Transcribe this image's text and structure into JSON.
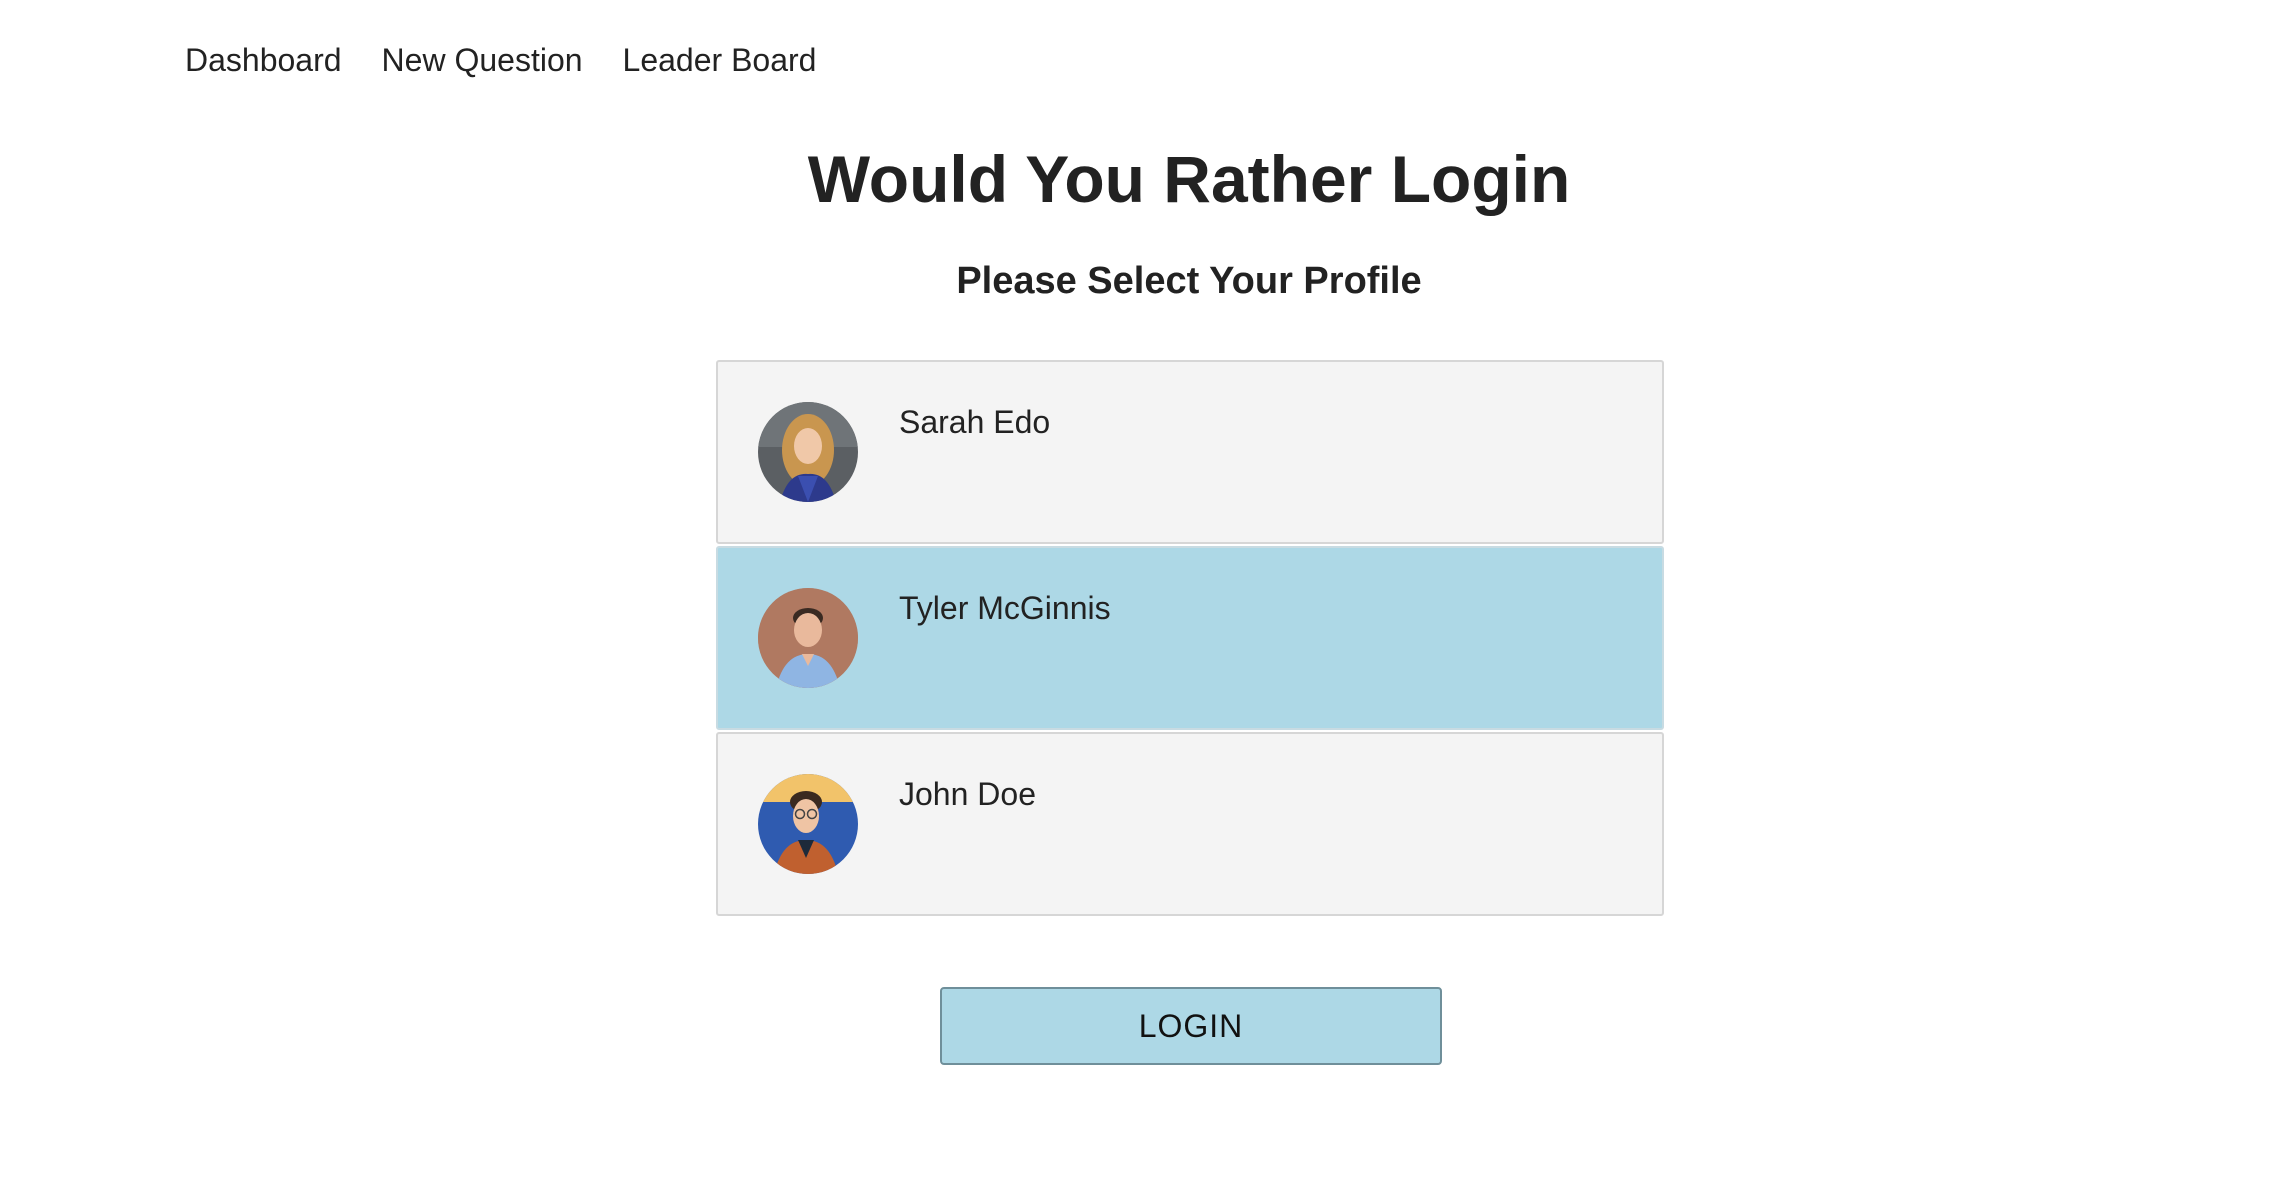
{
  "nav": {
    "items": [
      {
        "label": "Dashboard"
      },
      {
        "label": "New Question"
      },
      {
        "label": "Leader Board"
      }
    ]
  },
  "main": {
    "title": "Would You Rather Login",
    "subtitle": "Please Select Your Profile"
  },
  "profiles": [
    {
      "name": "Sarah Edo",
      "avatar_icon": "avatar-photo-sarah",
      "selected": false
    },
    {
      "name": "Tyler McGinnis",
      "avatar_icon": "avatar-photo-tyler",
      "selected": true
    },
    {
      "name": "John Doe",
      "avatar_icon": "avatar-photo-john",
      "selected": false
    }
  ],
  "login": {
    "label": "LOGIN"
  },
  "colors": {
    "selected_background": "#add8e6",
    "card_background": "#f4f4f4",
    "button_background": "#add8e6",
    "text": "#222222"
  }
}
